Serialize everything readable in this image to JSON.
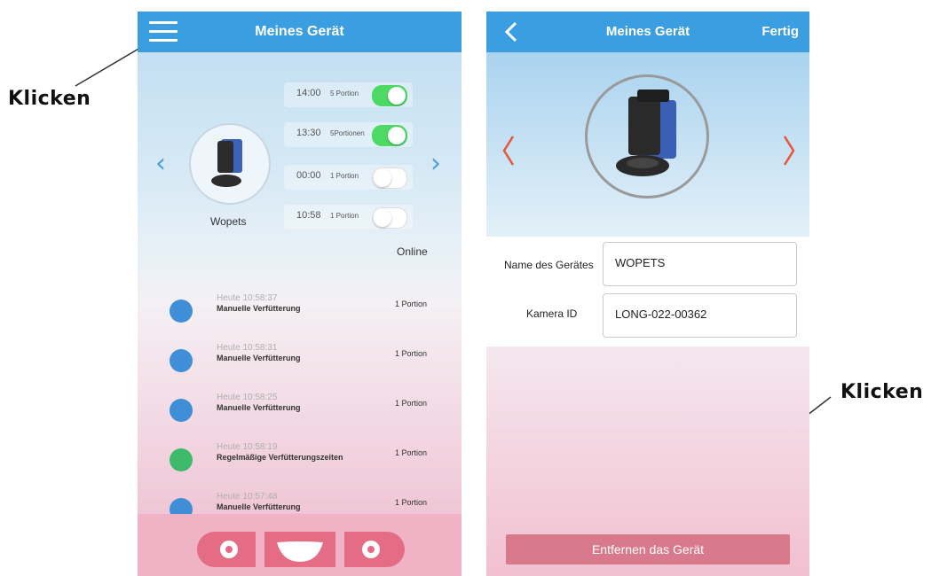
{
  "annotations": {
    "left_label": "Klicken",
    "right_label": "Klicken"
  },
  "left_screen": {
    "title": "Meines Gerät",
    "device_name": "Wopets",
    "status": "Online",
    "schedules": [
      {
        "time": "14:00",
        "portion": "5 Portion",
        "enabled": true
      },
      {
        "time": "13:30",
        "portion": "5Portionen",
        "enabled": true
      },
      {
        "time": "00:00",
        "portion": "1 Portion",
        "enabled": false
      },
      {
        "time": "10:58",
        "portion": "1 Portion",
        "enabled": false
      }
    ],
    "log": [
      {
        "time": "Heute 10:58:37",
        "desc": "Manuelle Verfütterung",
        "portion": "1 Portion",
        "icon": "hand-icon"
      },
      {
        "time": "Heute 10:58:31",
        "desc": "Manuelle Verfütterung",
        "portion": "1 Portion",
        "icon": "hand-icon"
      },
      {
        "time": "Heute 10:58:25",
        "desc": "Manuelle Verfütterung",
        "portion": "1 Portion",
        "icon": "hand-icon"
      },
      {
        "time": "Heute 10:58:19",
        "desc": "Regelmäßige Verfütterungszeiten",
        "portion": "1 Portion",
        "icon": "alarm-clock-icon"
      },
      {
        "time": "Heute 10:57:48",
        "desc": "Manuelle Verfütterung",
        "portion": "1 Portion",
        "icon": "hand-icon"
      }
    ],
    "tabs": [
      "camera-icon",
      "bowl-icon",
      "gear-icon"
    ]
  },
  "right_screen": {
    "title": "Meines Gerät",
    "done_label": "Fertig",
    "name_label": "Name des Gerätes",
    "name_value": "WOPETS",
    "camera_label": "Kamera ID",
    "camera_value": "LONG-022-00362",
    "remove_label": "Entfernen das Gerät"
  },
  "colors": {
    "header_blue": "#3b9ee0",
    "toggle_on": "#4cd964",
    "arrow_red": "#e8553a",
    "remove_button": "#d97a8c",
    "tab_button": "#e46c84"
  }
}
